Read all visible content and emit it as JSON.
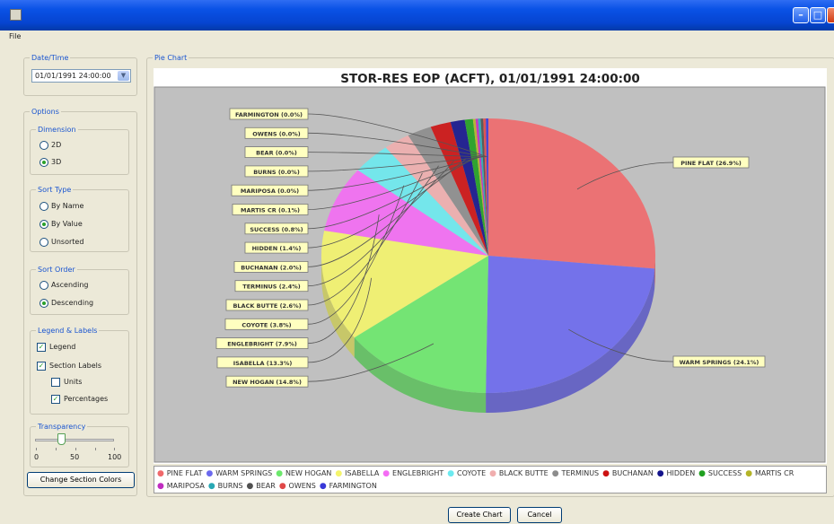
{
  "menu": {
    "file": "File"
  },
  "datetime": {
    "title": "Date/Time",
    "value": "01/01/1991 24:00:00"
  },
  "options": {
    "title": "Options",
    "dimension": {
      "title": "Dimension",
      "options": [
        "2D",
        "3D"
      ],
      "selected": "3D"
    },
    "sort_type": {
      "title": "Sort Type",
      "options": [
        "By Name",
        "By Value",
        "Unsorted"
      ],
      "selected": "By Value"
    },
    "sort_order": {
      "title": "Sort Order",
      "options": [
        "Ascending",
        "Descending"
      ],
      "selected": "Descending"
    },
    "legend_labels": {
      "title": "Legend & Labels",
      "legend": {
        "label": "Legend",
        "checked": true
      },
      "section_labels": {
        "label": "Section Labels",
        "checked": true
      },
      "units": {
        "label": "Units",
        "checked": false
      },
      "percentages": {
        "label": "Percentages",
        "checked": true
      }
    },
    "transparency": {
      "title": "Transparency",
      "value": 40,
      "min_label": "0",
      "mid_label": "50",
      "max_label": "100"
    },
    "change_colors_label": "Change Section Colors"
  },
  "pie_panel": {
    "title": "Pie Chart"
  },
  "buttons": {
    "create": "Create Chart",
    "cancel": "Cancel"
  },
  "chart_data": {
    "type": "pie",
    "title": "STOR-RES EOP (ACFT), 01/01/1991 24:00:00",
    "slices": [
      {
        "name": "PINE FLAT",
        "percent": 26.9,
        "label": "PINE FLAT (26.9%)",
        "color": "#f0696b"
      },
      {
        "name": "WARM SPRINGS",
        "percent": 24.1,
        "label": "WARM SPRINGS (24.1%)",
        "color": "#6b69ee"
      },
      {
        "name": "NEW HOGAN",
        "percent": 14.8,
        "label": "NEW HOGAN (14.8%)",
        "color": "#6ce86c"
      },
      {
        "name": "ISABELLA",
        "percent": 13.3,
        "label": "ISABELLA (13.3%)",
        "color": "#f4f46c"
      },
      {
        "name": "ENGLEBRIGHT",
        "percent": 7.9,
        "label": "ENGLEBRIGHT (7.9%)",
        "color": "#f46cf4"
      },
      {
        "name": "COYOTE",
        "percent": 3.8,
        "label": "COYOTE (3.8%)",
        "color": "#6ceaf0"
      },
      {
        "name": "BLACK BUTTE",
        "percent": 2.6,
        "label": "BLACK BUTTE (2.6%)",
        "color": "#f0aeae"
      },
      {
        "name": "TERMINUS",
        "percent": 2.4,
        "label": "TERMINUS (2.4%)",
        "color": "#8c8c8c"
      },
      {
        "name": "BUCHANAN",
        "percent": 2.0,
        "label": "BUCHANAN (2.0%)",
        "color": "#cc1111"
      },
      {
        "name": "HIDDEN",
        "percent": 1.4,
        "label": "HIDDEN (1.4%)",
        "color": "#14148c"
      },
      {
        "name": "SUCCESS",
        "percent": 0.8,
        "label": "SUCCESS (0.8%)",
        "color": "#20a020"
      },
      {
        "name": "MARTIS CR",
        "percent": 0.1,
        "label": "MARTIS CR (0.1%)",
        "color": "#b4b428"
      },
      {
        "name": "MARIPOSA",
        "percent": 0.0,
        "label": "MARIPOSA (0.0%)",
        "color": "#c02cc0"
      },
      {
        "name": "BURNS",
        "percent": 0.0,
        "label": "BURNS (0.0%)",
        "color": "#28a8b4"
      },
      {
        "name": "BEAR",
        "percent": 0.0,
        "label": "BEAR (0.0%)",
        "color": "#505050"
      },
      {
        "name": "OWENS",
        "percent": 0.0,
        "label": "OWENS (0.0%)",
        "color": "#e04848"
      },
      {
        "name": "FARMINGTON",
        "percent": 0.0,
        "label": "FARMINGTON (0.0%)",
        "color": "#3838d8"
      }
    ],
    "legend": {
      "shown": true,
      "placement": "bottom"
    }
  }
}
